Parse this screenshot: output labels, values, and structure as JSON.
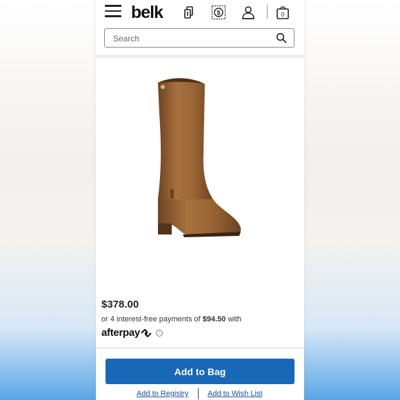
{
  "header": {
    "logo": "belk",
    "icons": [
      "menu-icon",
      "store-icon",
      "deals-icon",
      "account-icon",
      "cart-icon"
    ],
    "cart_count": "0"
  },
  "search": {
    "placeholder": "Search"
  },
  "product": {
    "image": "brown-tall-leather-boot",
    "price": "$378.00",
    "installment_prefix": "or 4 interest-free payments of ",
    "installment_amount": "$94.50",
    "installment_suffix": " with",
    "afterpay_label": "afterpay",
    "info_symbol": "i"
  },
  "actions": {
    "add_to_bag": "Add to Bag",
    "add_to_registry": "Add to Registry",
    "add_to_wish_list": "Add to Wish List"
  },
  "colors": {
    "primary": "#1768b6",
    "link": "#1a4f9c"
  }
}
